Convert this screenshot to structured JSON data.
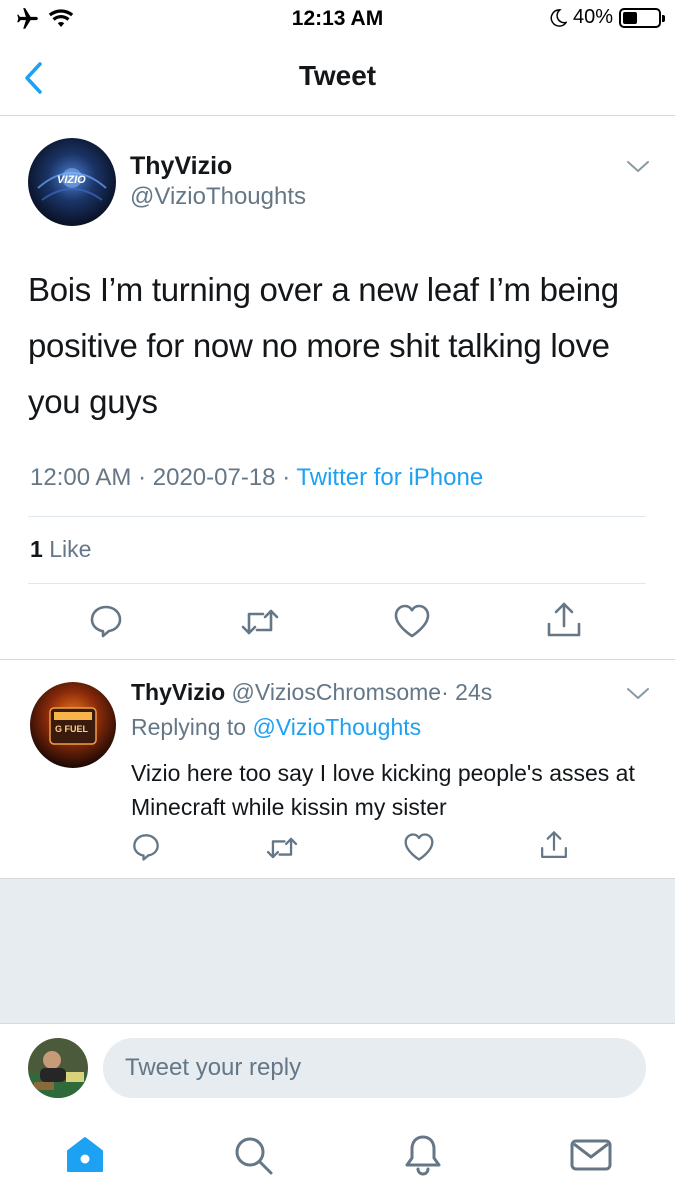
{
  "status_bar": {
    "time": "12:13 AM",
    "battery_percent": "40%",
    "battery_level": 0.4
  },
  "nav": {
    "title": "Tweet",
    "back_icon": "chevron-left-icon"
  },
  "tweet": {
    "name": "ThyVizio",
    "handle": "@VizioThoughts",
    "avatar_label": "VIZIO",
    "text": "Bois I’m turning over a new leaf I’m being positive for now no more shit talking love you guys",
    "time": "12:00 AM",
    "date": "2020-07-18",
    "separator": "·",
    "source": "Twitter for iPhone",
    "like_count": "1",
    "like_label": "Like",
    "actions": [
      "reply-icon",
      "retweet-icon",
      "heart-icon",
      "share-icon"
    ]
  },
  "reply": {
    "name": "ThyVizio",
    "handle": "@ViziosChromsome",
    "age": "24s",
    "separator": "·",
    "replying_label": "Replying to",
    "replying_to": "@VizioThoughts",
    "avatar_label": "G FUEL",
    "text": "Vizio here too say I love kicking people's asses at Minecraft while kissin my sister"
  },
  "composer": {
    "placeholder": "Tweet your reply",
    "value": ""
  },
  "tab_bar": {
    "items": [
      "home-icon",
      "search-icon",
      "notifications-icon",
      "messages-icon"
    ],
    "active_color": "#1da1f2"
  },
  "colors": {
    "accent": "#1da1f2",
    "secondary_text": "#657786",
    "divider": "#e1e8ed",
    "background_grey": "#e6ecf0"
  }
}
